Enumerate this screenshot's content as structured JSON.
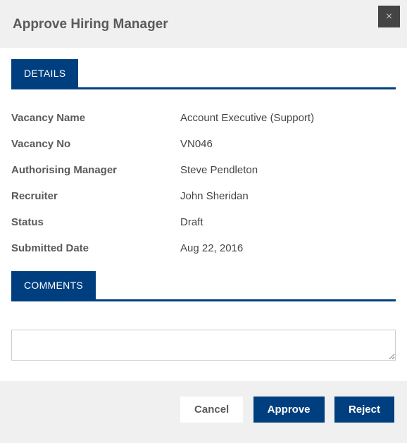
{
  "header": {
    "title": "Approve Hiring Manager",
    "close_glyph": "×"
  },
  "sections": {
    "details_tab": "DETAILS",
    "comments_tab": "COMMENTS"
  },
  "details": [
    {
      "label": "Vacancy Name",
      "value": "Account Executive (Support)"
    },
    {
      "label": "Vacancy No",
      "value": "VN046"
    },
    {
      "label": "Authorising Manager",
      "value": "Steve Pendleton"
    },
    {
      "label": "Recruiter",
      "value": "John Sheridan"
    },
    {
      "label": "Status",
      "value": "Draft"
    },
    {
      "label": "Submitted Date",
      "value": "Aug 22, 2016"
    }
  ],
  "comments": {
    "value": ""
  },
  "footer": {
    "cancel": "Cancel",
    "approve": "Approve",
    "reject": "Reject"
  }
}
